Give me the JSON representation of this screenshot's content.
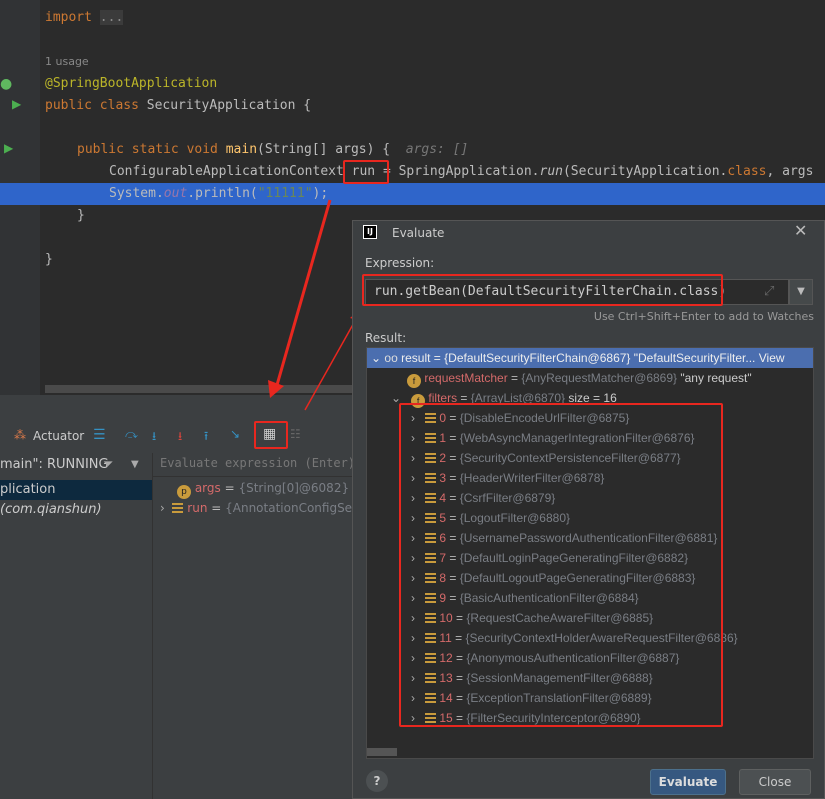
{
  "editor": {
    "import_kw": "import",
    "import_fold": "...",
    "usage_hint": "1 usage",
    "annotation": "@SpringBootApplication",
    "class_decl": {
      "kw": "public class ",
      "name": "SecurityApplication {"
    },
    "main_decl": {
      "kw": "public static void ",
      "name": "main",
      "rest": "(String[] args) {",
      "hint": "args: []"
    },
    "line_run": {
      "type": "ConfigurableApplicationContext ",
      "var": "run",
      "rest_a": " = SpringApplication.",
      "call": "run",
      "rest_b": "(SecurityApplication.",
      "cls": "class",
      ", ": ", args"
    },
    "line_print": {
      "a": "System.",
      "out": "out",
      "b": ".println(",
      "str": "\"11111\"",
      "c": ");"
    },
    "close1": "}",
    "close2": "}"
  },
  "debugger": {
    "actuator_label": "Actuator",
    "thread_status": "main\": RUNNING",
    "frame": "plication",
    "frame_pkg": "(com.qianshun)",
    "evaluate_placeholder": "Evaluate expression (Enter)",
    "variables": [
      {
        "name": "args",
        "value": "{String[0]@6082} []"
      },
      {
        "name": "run",
        "value": "{AnnotationConfigSe"
      }
    ]
  },
  "dialog": {
    "title": "Evaluate",
    "expression_label": "Expression:",
    "expression": "run.getBean(DefaultSecurityFilterChain.class)",
    "hint": "Use Ctrl+Shift+Enter to add to Watches",
    "result_label": "Result:",
    "result": {
      "name": "result",
      "value": "= {DefaultSecurityFilterChain@6867} \"DefaultSecurityFilter...",
      "view": "View"
    },
    "request_matcher": {
      "name": "requestMatcher",
      "value": "{AnyRequestMatcher@6869}",
      "extra": "\"any request\""
    },
    "filters": {
      "name": "filters",
      "value": "{ArrayList@6870}",
      "extra": "size = 16"
    },
    "filter_items": [
      {
        "i": "0",
        "v": "{DisableEncodeUrlFilter@6875}"
      },
      {
        "i": "1",
        "v": "{WebAsyncManagerIntegrationFilter@6876}"
      },
      {
        "i": "2",
        "v": "{SecurityContextPersistenceFilter@6877}"
      },
      {
        "i": "3",
        "v": "{HeaderWriterFilter@6878}"
      },
      {
        "i": "4",
        "v": "{CsrfFilter@6879}"
      },
      {
        "i": "5",
        "v": "{LogoutFilter@6880}"
      },
      {
        "i": "6",
        "v": "{UsernamePasswordAuthenticationFilter@6881}"
      },
      {
        "i": "7",
        "v": "{DefaultLoginPageGeneratingFilter@6882}"
      },
      {
        "i": "8",
        "v": "{DefaultLogoutPageGeneratingFilter@6883}"
      },
      {
        "i": "9",
        "v": "{BasicAuthenticationFilter@6884}"
      },
      {
        "i": "10",
        "v": "{RequestCacheAwareFilter@6885}"
      },
      {
        "i": "11",
        "v": "{SecurityContextHolderAwareRequestFilter@6886}"
      },
      {
        "i": "12",
        "v": "{AnonymousAuthenticationFilter@6887}"
      },
      {
        "i": "13",
        "v": "{SessionManagementFilter@6888}"
      },
      {
        "i": "14",
        "v": "{ExceptionTranslationFilter@6889}"
      },
      {
        "i": "15",
        "v": "{FilterSecurityInterceptor@6890}"
      }
    ],
    "evaluate_button": "Evaluate",
    "close_button": "Close",
    "help": "?"
  },
  "colors": {
    "accent": "#4b6eaf",
    "selection": "#2f65ca",
    "annotation_red": "#e8271f"
  }
}
